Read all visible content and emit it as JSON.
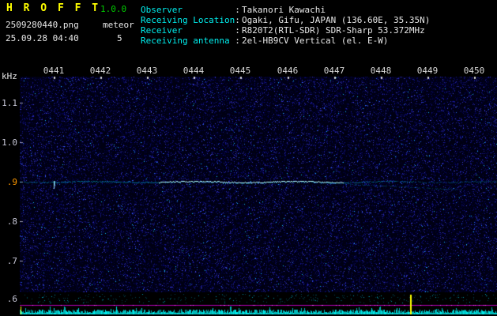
{
  "header": {
    "app_title": "H R O F F T",
    "version": "1.0.0",
    "filename": "2509280440.png",
    "mode": "meteor",
    "datetime": "25.09.28 04:40",
    "count": "5",
    "separator": ":",
    "info": [
      {
        "label": "Observer",
        "value": "Takanori Kawachi"
      },
      {
        "label": "Receiving Location",
        "value": "Ogaki, Gifu, JAPAN (136.60E, 35.35N)"
      },
      {
        "label": "Receiver",
        "value": "R820T2(RTL-SDR) SDR-Sharp 53.372MHz"
      },
      {
        "label": "Receiving antenna",
        "value": "2el-HB9CV Vertical (el. E-W)"
      }
    ]
  },
  "axes": {
    "unit_label": "kHz",
    "time_labels": [
      "0441",
      "0442",
      "0443",
      "0444",
      "0445",
      "0446",
      "0447",
      "0448",
      "0449",
      "0450"
    ],
    "freq_labels": [
      {
        "text": "1.1"
      },
      {
        "text": "1.0"
      },
      {
        "text": ".9",
        "highlight": true
      },
      {
        "text": ".8"
      },
      {
        "text": ".7"
      },
      {
        "text": ".6"
      }
    ]
  },
  "spectrogram": {
    "time_start": "0441",
    "time_end": "0450",
    "freq_unit": "kHz",
    "freq_min": 0.6,
    "freq_max": 1.1,
    "signal_line_khz": 0.9
  },
  "colors": {
    "title_yellow": "#ffff00",
    "version_green": "#00cc00",
    "info_label_cyan": "#00eeee",
    "info_value_white": "#e8e8e8",
    "freq_highlight_orange": "#ff9900",
    "signal_line_cyan": "#00e0ff",
    "meter_line_magenta": "#b400b4",
    "meter_noise_cyan": "#00cccc",
    "meter_spike_yellow": "#ffff00",
    "noise_blue": "#2222aa"
  }
}
